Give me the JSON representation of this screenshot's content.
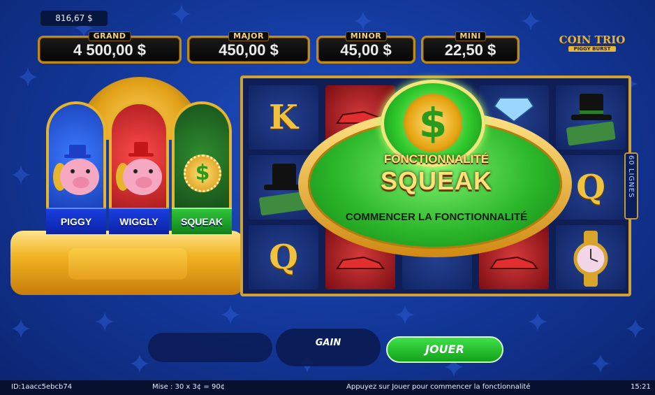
{
  "balance": "816,67 $",
  "jackpots": [
    {
      "label": "GRAND",
      "value": "4 500,00 $"
    },
    {
      "label": "MAJOR",
      "value": "450,00 $"
    },
    {
      "label": "MINOR",
      "value": "45,00 $"
    },
    {
      "label": "MINI",
      "value": "22,50 $"
    }
  ],
  "logo": {
    "line1": "COIN TRIO",
    "line2": "PIGGY BURST"
  },
  "booths": [
    {
      "name": "PIGGY",
      "color": "#2b62e6"
    },
    {
      "name": "WIGGLY",
      "color": "#e02828"
    },
    {
      "name": "SQUEAK",
      "color": "#2cae2a"
    }
  ],
  "reels": {
    "lines_label": "60 LIGNES",
    "symbols": {
      "king": "K",
      "queen": "Q"
    }
  },
  "feature_popup": {
    "title": "FONCTIONNALITÉ",
    "name": "SQUEAK",
    "prompt": "COMMENCER LA FONCTIONNALITÉ",
    "dollar": "$"
  },
  "controls": {
    "gain_label": "GAIN",
    "play_label": "JOUER"
  },
  "footer": {
    "id": "ID:1aacc5ebcb74",
    "bet": "Mise : 30 x 3¢ = 90¢",
    "message": "Appuyez sur Jouer pour commencer la fonctionnalité",
    "time": "15:21"
  }
}
